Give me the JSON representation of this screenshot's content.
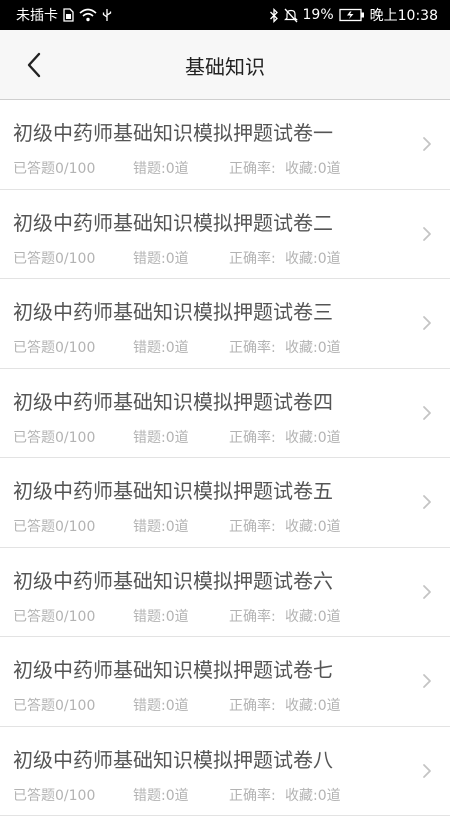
{
  "status_bar": {
    "carrier": "未插卡",
    "battery": "19%",
    "time": "晚上10:38",
    "icons": [
      "sim-icon",
      "wifi-icon",
      "usb-icon",
      "bluetooth-icon",
      "mute-icon",
      "battery-icon"
    ]
  },
  "nav": {
    "back_icon": "back-chevron-icon",
    "title": "基础知识"
  },
  "items": [
    {
      "title": "初级中药师基础知识模拟押题试卷一",
      "answered": "已答题0/100",
      "wrong": "错题:0道",
      "accuracy": "正确率:",
      "favorites": "收藏:0道"
    },
    {
      "title": "初级中药师基础知识模拟押题试卷二",
      "answered": "已答题0/100",
      "wrong": "错题:0道",
      "accuracy": "正确率:",
      "favorites": "收藏:0道"
    },
    {
      "title": "初级中药师基础知识模拟押题试卷三",
      "answered": "已答题0/100",
      "wrong": "错题:0道",
      "accuracy": "正确率:",
      "favorites": "收藏:0道"
    },
    {
      "title": "初级中药师基础知识模拟押题试卷四",
      "answered": "已答题0/100",
      "wrong": "错题:0道",
      "accuracy": "正确率:",
      "favorites": "收藏:0道"
    },
    {
      "title": "初级中药师基础知识模拟押题试卷五",
      "answered": "已答题0/100",
      "wrong": "错题:0道",
      "accuracy": "正确率:",
      "favorites": "收藏:0道"
    },
    {
      "title": "初级中药师基础知识模拟押题试卷六",
      "answered": "已答题0/100",
      "wrong": "错题:0道",
      "accuracy": "正确率:",
      "favorites": "收藏:0道"
    },
    {
      "title": "初级中药师基础知识模拟押题试卷七",
      "answered": "已答题0/100",
      "wrong": "错题:0道",
      "accuracy": "正确率:",
      "favorites": "收藏:0道"
    },
    {
      "title": "初级中药师基础知识模拟押题试卷八",
      "answered": "已答题0/100",
      "wrong": "错题:0道",
      "accuracy": "正确率:",
      "favorites": "收藏:0道"
    }
  ],
  "colors": {
    "status_bar_bg": "#000000",
    "nav_bg": "#f7f7f7",
    "title_text": "#555555",
    "meta_text": "#b3b3b3",
    "divider": "#e3e3e3"
  }
}
